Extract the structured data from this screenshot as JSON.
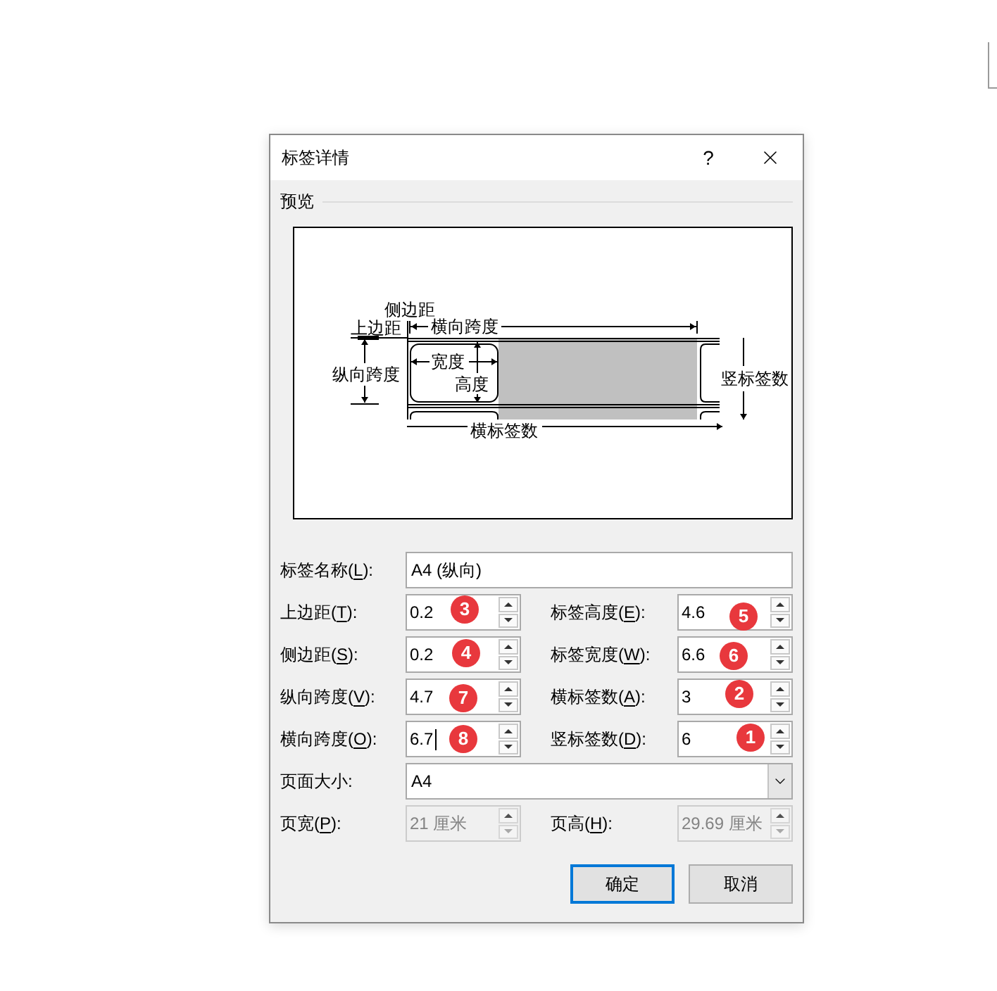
{
  "window": {
    "title": "标签详情",
    "help_button": "?"
  },
  "preview": {
    "title": "预览",
    "labels": [
      {
        "kind": "side_margin",
        "text": "侧边距"
      },
      {
        "kind": "top_margin",
        "text": "上边距"
      },
      {
        "kind": "horizontal_pitch",
        "text": "横向跨度"
      },
      {
        "kind": "vertical_pitch",
        "text": "纵向跨度"
      },
      {
        "kind": "width",
        "text": "宽度"
      },
      {
        "kind": "height",
        "text": "高度"
      },
      {
        "kind": "number_down",
        "text": "竖标签数"
      },
      {
        "kind": "number_across",
        "text": "横标签数"
      }
    ]
  },
  "label_name": {
    "label": {
      "before": "标签名称(",
      "key": "L",
      "after": "):"
    },
    "value": "A4 (纵向)"
  },
  "rows": [
    {
      "left": {
        "label": {
          "before": "上边距(",
          "key": "T",
          "after": "):"
        },
        "value": "0.2",
        "badge": "3",
        "focused": false
      },
      "right": {
        "label": {
          "before": "标签高度(",
          "key": "E",
          "after": "):"
        },
        "value": "4.6",
        "badge": "5",
        "focused": false
      }
    },
    {
      "left": {
        "label": {
          "before": "侧边距(",
          "key": "S",
          "after": "):"
        },
        "value": "0.2",
        "badge": "4",
        "focused": false
      },
      "right": {
        "label": {
          "before": "标签宽度(",
          "key": "W",
          "after": "):"
        },
        "value": "6.6",
        "badge": "6",
        "focused": false
      }
    },
    {
      "left": {
        "label": {
          "before": "纵向跨度(",
          "key": "V",
          "after": "):"
        },
        "value": "4.7",
        "badge": "7",
        "focused": false
      },
      "right": {
        "label": {
          "before": "横标签数(",
          "key": "A",
          "after": "):"
        },
        "value": "3",
        "badge": "2",
        "focused": false
      }
    },
    {
      "left": {
        "label": {
          "before": "横向跨度(",
          "key": "O",
          "after": "):"
        },
        "value": "6.7",
        "badge": "8",
        "focused": true
      },
      "right": {
        "label": {
          "before": "竖标签数(",
          "key": "D",
          "after": "):"
        },
        "value": "6",
        "badge": "1",
        "focused": false
      }
    }
  ],
  "page_size": {
    "label": {
      "before": "页面大小:"
    },
    "value": "A4"
  },
  "page_dims": [
    {
      "label": {
        "before": "页宽(",
        "key": "P",
        "after": "):"
      },
      "value": "21 厘米",
      "disabled": true
    },
    {
      "label": {
        "before": "页高(",
        "key": "H",
        "after": "):"
      },
      "value": "29.69 厘米",
      "disabled": true
    }
  ],
  "buttons": [
    {
      "label": "确定",
      "default": true
    },
    {
      "label": "取消",
      "default": false
    }
  ]
}
